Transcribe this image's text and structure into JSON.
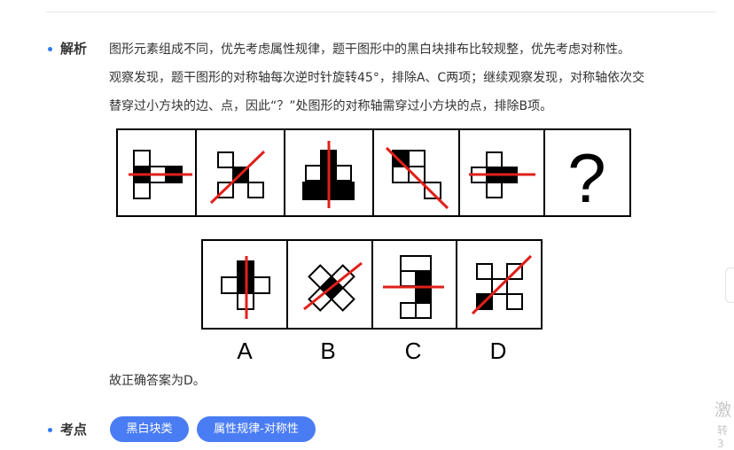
{
  "sections": {
    "analysis_label": "解析",
    "keypoint_label": "考点"
  },
  "analysis": {
    "line1": "图形元素组成不同，优先考虑属性规律，题干图形中的黑白块排布比较规整，优先考虑对称性。",
    "line2": "观察发现，题干图形的对称轴每次逆时针旋转45°，排除A、C两项；继续观察发现，对称轴依次交",
    "line3": "替穿过小方块的边、点，因此“？”处图形的对称轴需穿过小方块的点，排除B项。"
  },
  "question_figure": {
    "question_mark": "?"
  },
  "options": [
    "A",
    "B",
    "C",
    "D"
  ],
  "answer_text": "故正确答案为D。",
  "tags": [
    "黑白块类",
    "属性规律-对称性"
  ],
  "edge_chars": {
    "top": "激",
    "bottom": "转3"
  },
  "colors": {
    "accent": "#2f7bf5",
    "axis_red": "#e0201b",
    "tag_bg": "#4a7cf4"
  }
}
